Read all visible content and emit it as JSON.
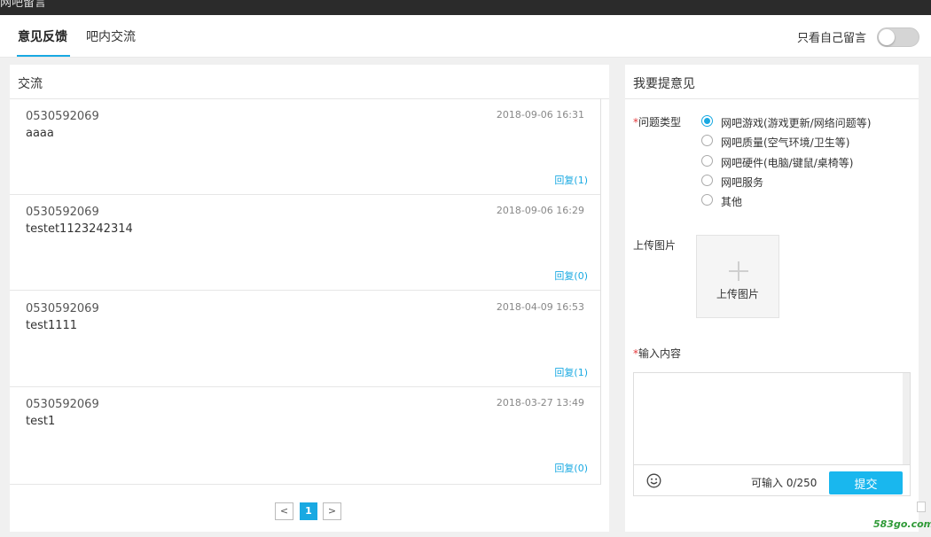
{
  "topbar": {
    "title": "网吧留言"
  },
  "header": {
    "tabs": [
      {
        "label": "意见反馈",
        "active": true
      },
      {
        "label": "吧内交流",
        "active": false
      }
    ],
    "toggle_label": "只看自己留言"
  },
  "exchange": {
    "title": "交流",
    "items": [
      {
        "user": "0530592069",
        "content": "aaaa",
        "time": "2018-09-06 16:31",
        "reply": "回复(1)"
      },
      {
        "user": "0530592069",
        "content": "testet1123242314",
        "time": "2018-09-06 16:29",
        "reply": "回复(0)"
      },
      {
        "user": "0530592069",
        "content": "test1111",
        "time": "2018-04-09 16:53",
        "reply": "回复(1)"
      },
      {
        "user": "0530592069",
        "content": "test1",
        "time": "2018-03-27 13:49",
        "reply": "回复(0)"
      }
    ],
    "pagination": {
      "prev": "<",
      "current": "1",
      "next": ">"
    }
  },
  "feedback": {
    "title": "我要提意见",
    "required_mark": "*",
    "type_label": "问题类型",
    "options": [
      {
        "label": "网吧游戏(游戏更新/网络问题等)",
        "checked": true
      },
      {
        "label": "网吧质量(空气环境/卫生等)",
        "checked": false
      },
      {
        "label": "网吧硬件(电脑/键鼠/桌椅等)",
        "checked": false
      },
      {
        "label": "网吧服务",
        "checked": false
      },
      {
        "label": "其他",
        "checked": false
      }
    ],
    "upload_label": "上传图片",
    "upload_button": "上传图片",
    "content_label": "输入内容",
    "counter": "可输入 0/250",
    "submit": "提交"
  },
  "watermark": "583go.com",
  "colors": {
    "accent": "#19a9e2",
    "submit": "#19b7ee",
    "required": "#e4393c"
  }
}
